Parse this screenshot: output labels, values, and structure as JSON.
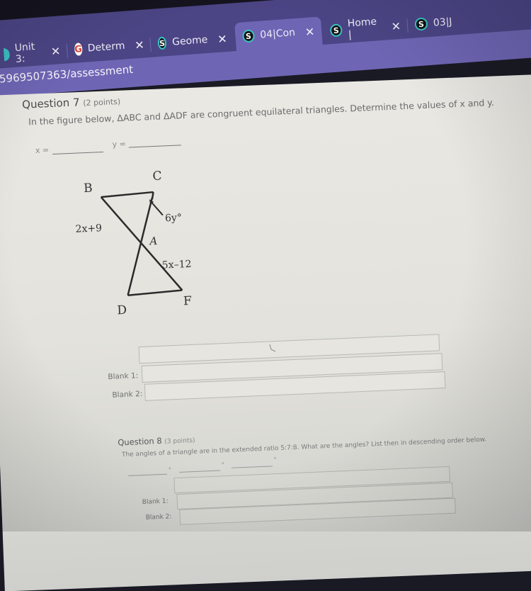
{
  "browser": {
    "tabs": [
      {
        "label": "Unit 3:",
        "icon": "schoology-icon",
        "active": false
      },
      {
        "label": "Determ",
        "icon": "google-icon",
        "active": false
      },
      {
        "label": "Geome",
        "icon": "schoology-icon",
        "active": false
      },
      {
        "label": "04|Con",
        "icon": "schoology-icon",
        "active": true
      },
      {
        "label": "Home |",
        "icon": "schoology-icon",
        "active": false
      },
      {
        "label": "03|J",
        "icon": "schoology-icon",
        "active": false
      }
    ],
    "close_glyph": "✕",
    "address": "5969507363/assessment"
  },
  "question7": {
    "title": "Question 7",
    "points": "(2 points)",
    "text": "In the figure below, ΔABC and ΔADF are congruent equilateral triangles. Determine the values of x and y.",
    "x_label": "x =",
    "y_label": "y =",
    "figure": {
      "vertices": {
        "B": "B",
        "C": "C",
        "A": "A",
        "D": "D",
        "F": "F"
      },
      "label_BA": "2x+9",
      "label_angle_C": "6y°",
      "label_AF": "5x–12"
    },
    "blanks": [
      {
        "label": "Blank 1:",
        "value": ""
      },
      {
        "label": "Blank 2:",
        "value": ""
      }
    ]
  },
  "question8": {
    "title": "Question 8",
    "points": "(3 points)",
    "text": "The angles of a triangle are in the extended ratio 5:7:8. What are the angles? List then in descending order below.",
    "degree_glyph": "°",
    "blanks": [
      {
        "label": "Blank 1:",
        "value": ""
      },
      {
        "label": "Blank 2:",
        "value": ""
      }
    ]
  }
}
